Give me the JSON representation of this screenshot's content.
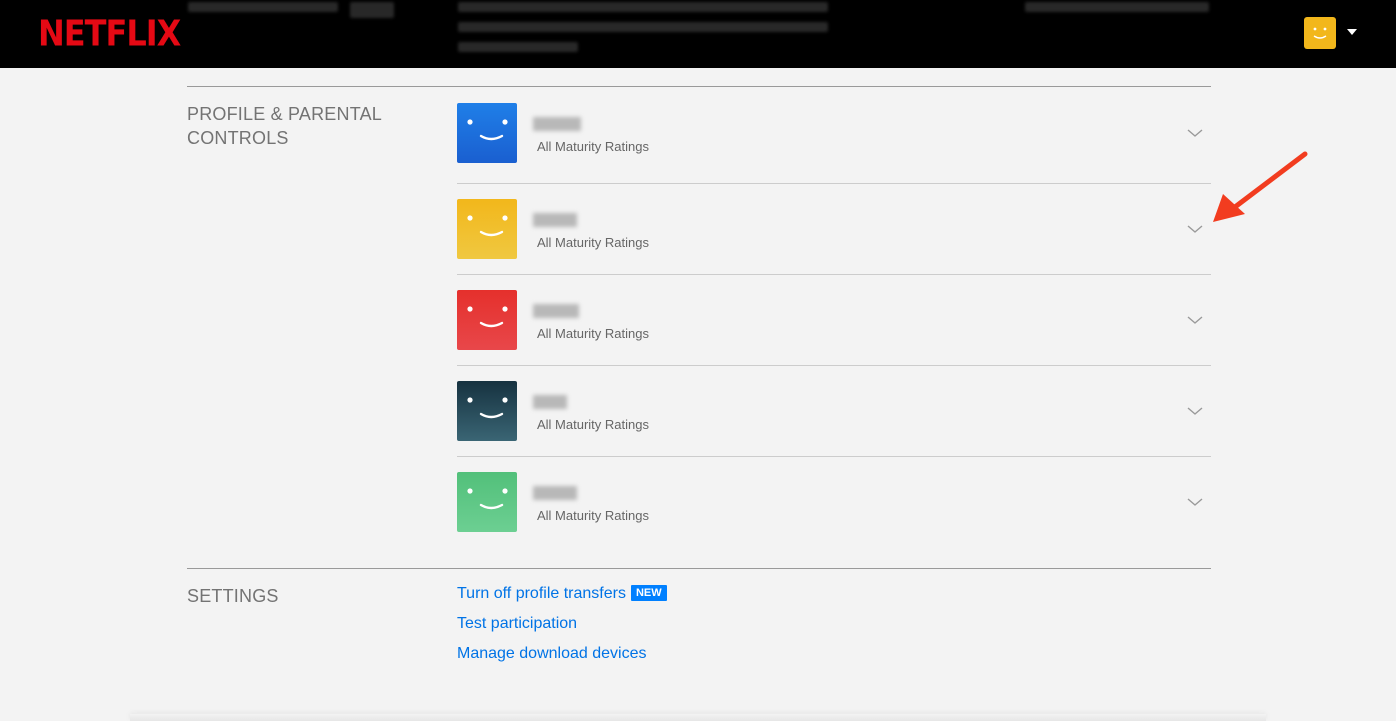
{
  "header": {
    "logo": "NETFLIX",
    "icons": [
      "profile-avatar",
      "caret-down-icon"
    ]
  },
  "sections": {
    "profile": {
      "title": "PROFILE & PARENTAL CONTROLS"
    },
    "settings": {
      "title": "SETTINGS"
    }
  },
  "profiles": [
    {
      "maturity": "All Maturity Ratings",
      "color": "#1f6fe0"
    },
    {
      "maturity": "All Maturity Ratings",
      "color": "#f2b71b"
    },
    {
      "maturity": "All Maturity Ratings",
      "color": "#e5302c"
    },
    {
      "maturity": "All Maturity Ratings",
      "color": "#1e3d4d"
    },
    {
      "maturity": "All Maturity Ratings",
      "color": "#4fc07a"
    }
  ],
  "settings_links": {
    "transfers": "Turn off profile transfers",
    "transfers_badge": "NEW",
    "test": "Test participation",
    "devices": "Manage download devices"
  },
  "colors": {
    "brand": "#e50914",
    "link": "#0073e6",
    "badge": "#0080ff",
    "annotation_arrow": "#f23c1f"
  }
}
